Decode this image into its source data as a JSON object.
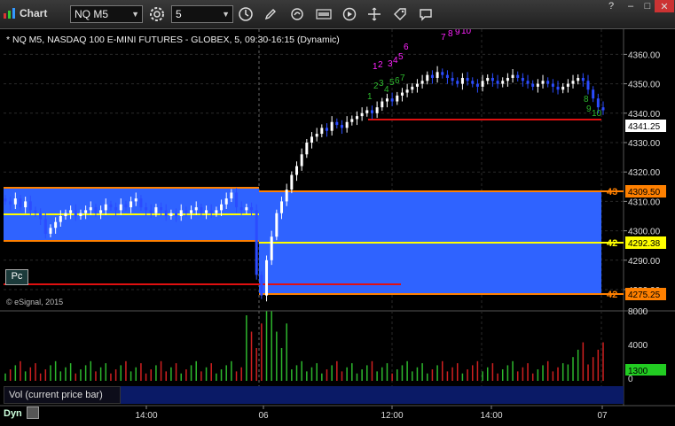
{
  "window": {
    "title": "Chart"
  },
  "toolbar": {
    "symbol_value": "NQ M5",
    "interval_value": "5",
    "icons": [
      "gear-icon",
      "clock-icon",
      "pencil-icon",
      "cursor-icon",
      "quote-icon",
      "play-icon",
      "arrows-icon",
      "comment-icon"
    ]
  },
  "chart": {
    "header": "* NQ M5, NASDAQ 100 E-MINI FUTURES - GLOBEX, 5, 09:30-16:15 (Dynamic)",
    "watermark": "© eSignal, 2015",
    "price_ticks": [
      "4360.00",
      "4350.00",
      "4340.00",
      "4330.00",
      "4320.00",
      "4310.00",
      "4300.00",
      "4290.00",
      "4280.00"
    ],
    "price_labels": [
      {
        "value": "4341.25",
        "color": "#ffffff"
      },
      {
        "value": "4309.50",
        "color": "#ff8000"
      },
      {
        "value": "4292.38",
        "color": "#ffff00"
      },
      {
        "value": "4275.25",
        "color": "#ff8000"
      }
    ],
    "level_tags": [
      {
        "text": "43",
        "color": "#ff8000"
      },
      {
        "text": "42",
        "color": "#ffff00"
      },
      {
        "text": "42",
        "color": "#ff8000"
      }
    ],
    "time_ticks": [
      "14:00",
      "06",
      "12:00",
      "14:00",
      "07"
    ],
    "pc_label": "Pc",
    "sequence_labels": [
      "1",
      "2",
      "3",
      "4",
      "5",
      "6",
      "7",
      "8",
      "9",
      "10"
    ]
  },
  "volume": {
    "label": "Vol (current price bar)",
    "ticks": [
      "8000",
      "4000",
      "0"
    ],
    "current_value": "1300"
  },
  "status": {
    "mode": "Dyn"
  },
  "colors": {
    "box": "#2f63ff",
    "bull": "#ffffff",
    "bear": "#2b4cff",
    "orange": "#ff8000",
    "yellow": "#ffff00",
    "red": "#e01010",
    "magenta": "#ff22ff",
    "green": "#2db82d"
  }
}
